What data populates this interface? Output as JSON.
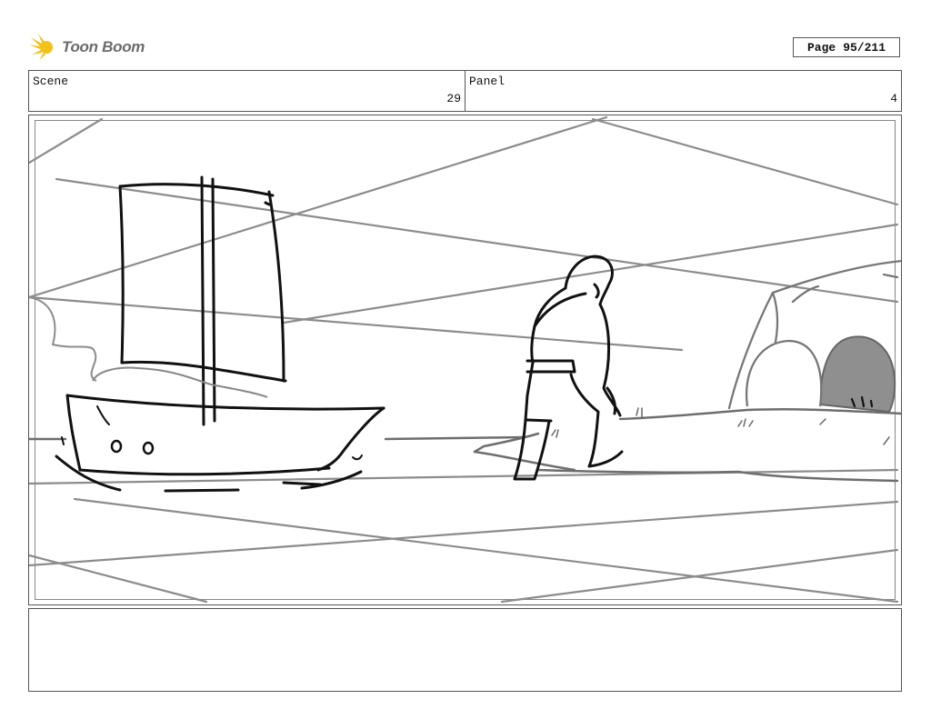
{
  "header": {
    "logo_text": "Toon Boom",
    "page_label": "Page",
    "page_value": "95/211"
  },
  "info": {
    "scene_label": "Scene",
    "scene_value": "29",
    "panel_label": "Panel",
    "panel_value": "4"
  },
  "drawing": {
    "subject": "storyboard sketch: sailboat at shore, figure walking toward cave"
  },
  "notes": {
    "text": ""
  }
}
